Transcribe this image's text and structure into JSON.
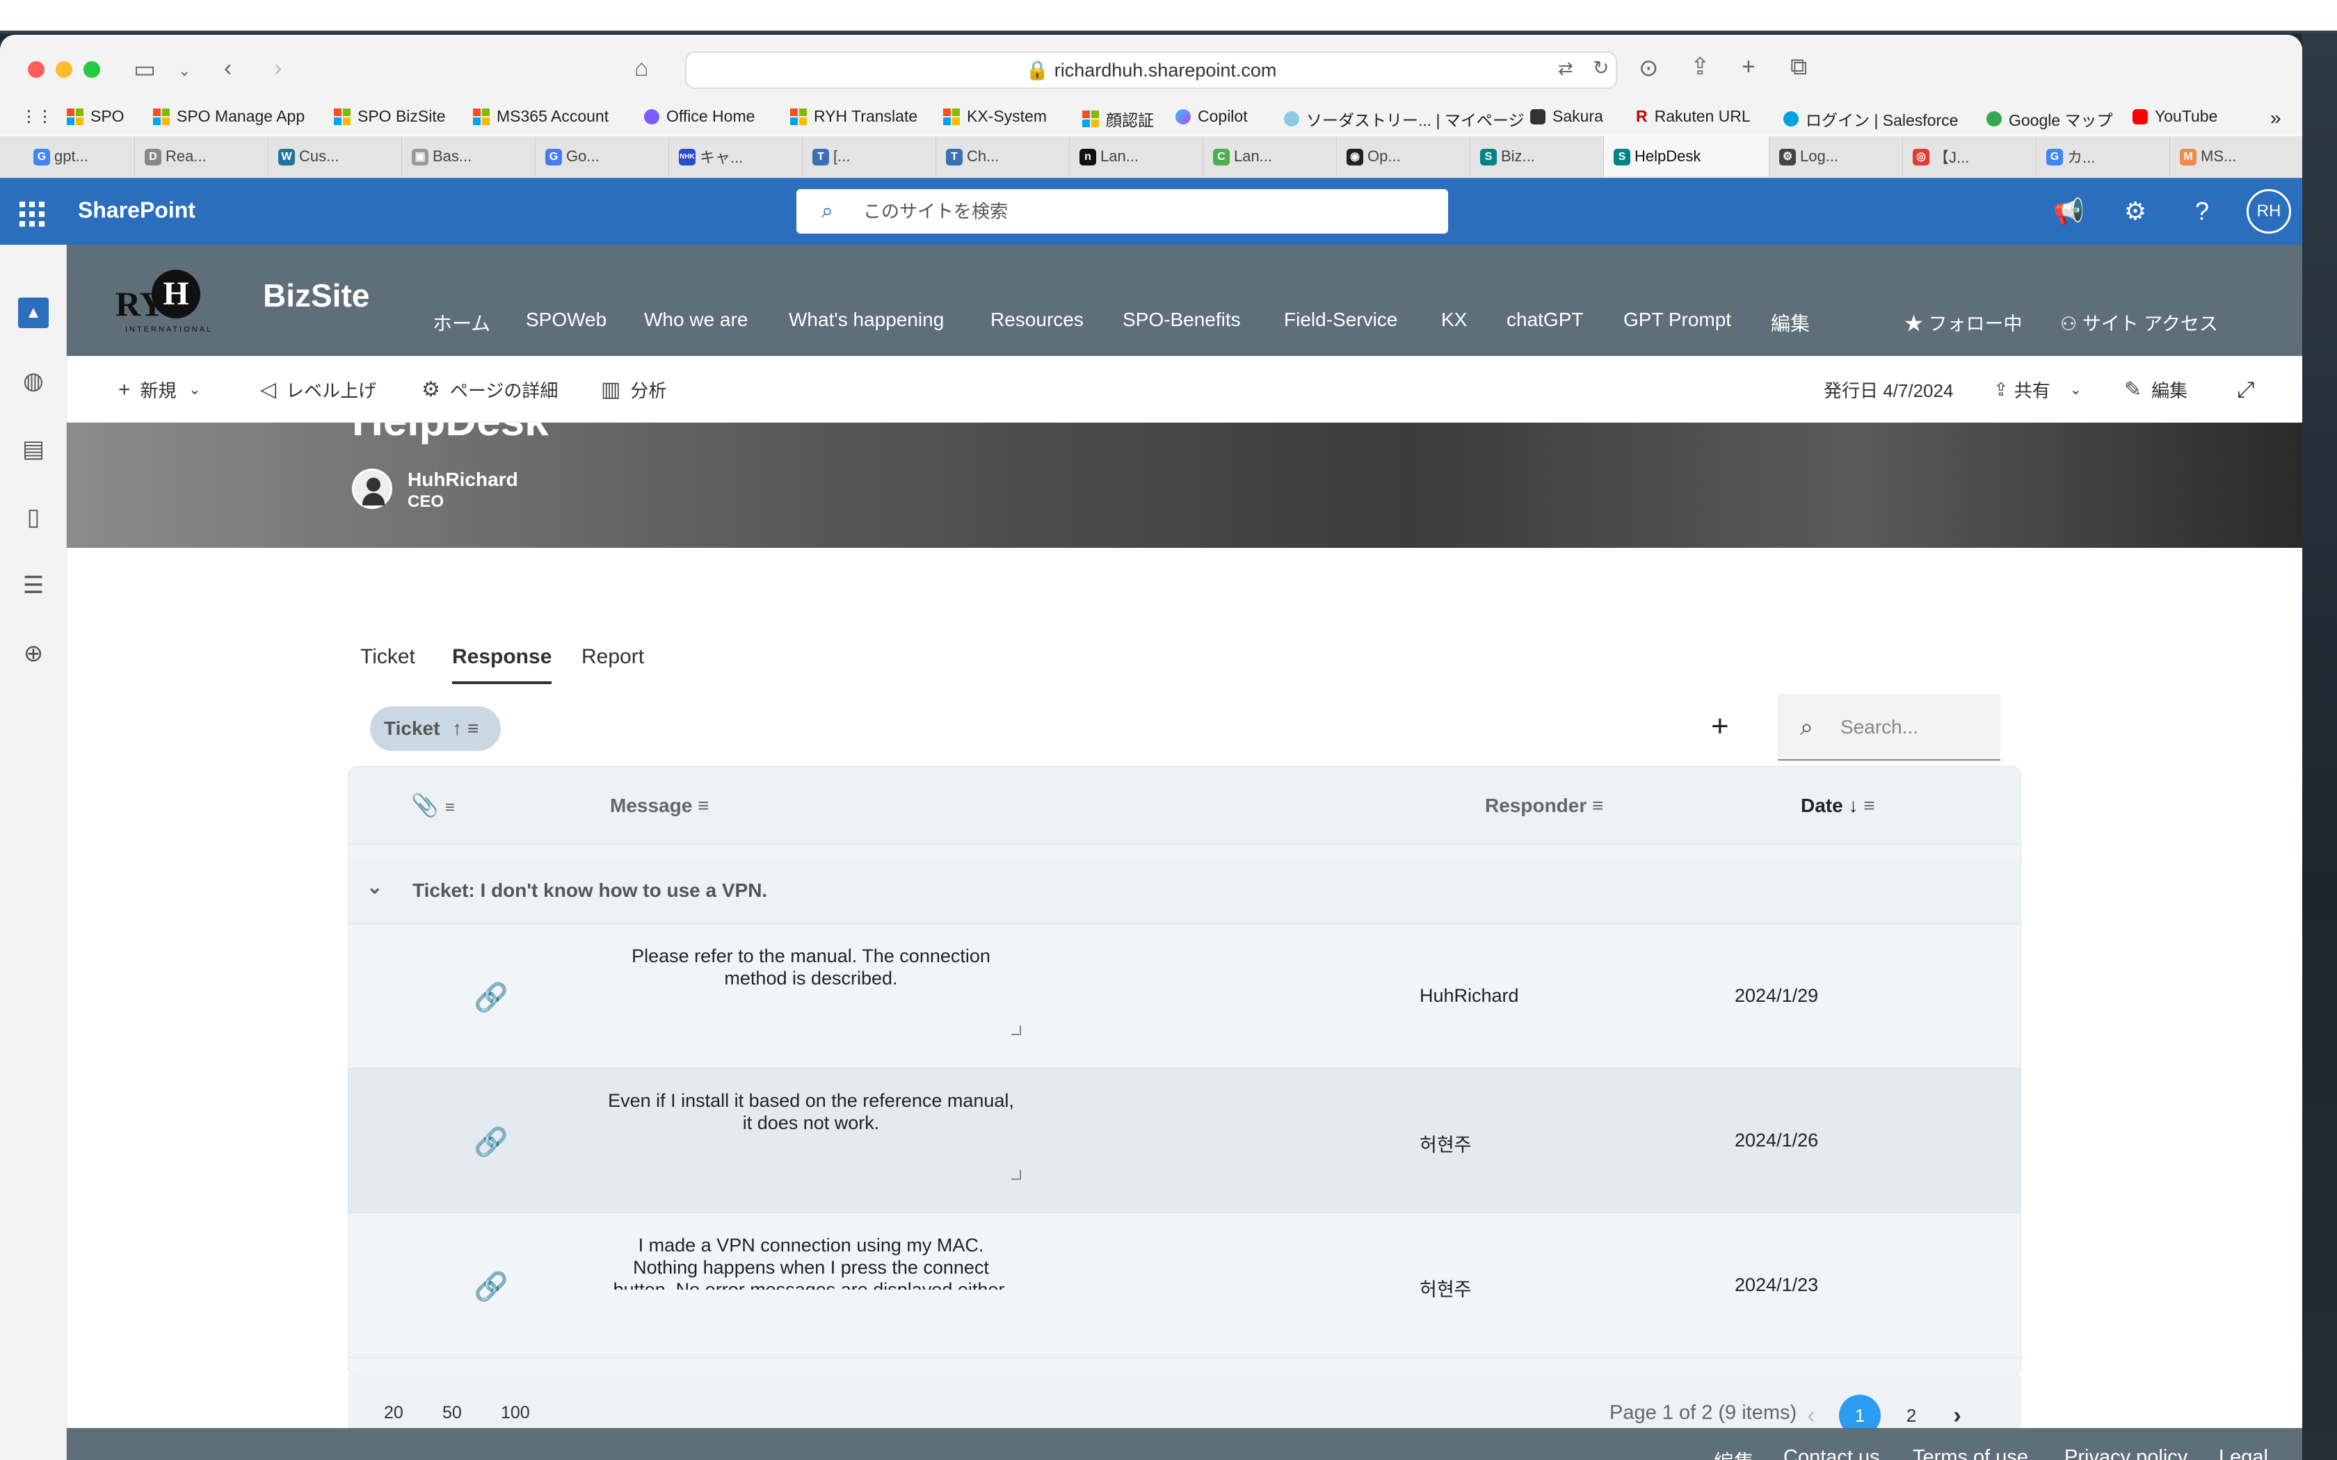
{
  "browser": {
    "url": "richardhuh.sharepoint.com",
    "bookmarks": [
      "SPO",
      "SPO Manage App",
      "SPO BizSite",
      "MS365 Account",
      "Office Home",
      "RYH Translate",
      "KX-System",
      "顔認証",
      "Copilot",
      "ソーダストリー... | マイページ",
      "Sakura",
      "Rakuten URL",
      "ログイン | Salesforce",
      "Google マップ",
      "YouTube"
    ],
    "tabs": [
      "gpt...",
      "Rea...",
      "Cus...",
      "Bas...",
      "Go...",
      "キャ...",
      "[...",
      "Ch...",
      "Lan...",
      "Lan...",
      "Op...",
      "Biz...",
      "HelpDesk",
      "Log...",
      "【J...",
      "カ...",
      "MS..."
    ],
    "active_tab": "HelpDesk"
  },
  "sharepoint": {
    "app_name": "SharePoint",
    "search_placeholder": "このサイトを検索",
    "avatar_initials": "RH"
  },
  "site": {
    "name": "BizSite",
    "logo_text": "RY",
    "logo_letter": "H",
    "logo_sub": "INTERNATIONAL",
    "nav": [
      "ホーム",
      "SPOWeb",
      "Who we are",
      "What's happening",
      "Resources",
      "SPO-Benefits",
      "Field-Service",
      "KX",
      "chatGPT",
      "GPT Prompt",
      "編集"
    ],
    "follow": "フォロー中",
    "site_access": "サイト アクセス"
  },
  "commandbar": {
    "new": "新規",
    "promote": "レベル上げ",
    "page_details": "ページの詳細",
    "analytics": "分析",
    "published": "発行日 4/7/2024",
    "share": "共有",
    "edit": "編集"
  },
  "hero": {
    "title": "HelpDesk",
    "author": "HuhRichard",
    "role": "CEO"
  },
  "page_tabs": [
    "Ticket",
    "Response",
    "Report"
  ],
  "selected_tab": "Response",
  "group_chip": "Ticket",
  "search_placeholder": "Search...",
  "table": {
    "columns": {
      "message": "Message",
      "responder": "Responder",
      "date": "Date"
    },
    "group_label": "Ticket: I don't know how to use a VPN.",
    "rows": [
      {
        "message": "Please refer to the manual. The connection method is described.",
        "responder": "HuhRichard",
        "date": "2024/1/29"
      },
      {
        "message": "Even if I install it based on the reference manual, it does not work.",
        "responder": "허현주",
        "date": "2024/1/26"
      },
      {
        "message": "I made a VPN connection using my MAC. Nothing happens when I press the connect button. No error messages are displayed either.",
        "responder": "허현주",
        "date": "2024/1/23"
      }
    ]
  },
  "pager": {
    "sizes": [
      "20",
      "50",
      "100"
    ],
    "info": "Page 1 of 2 (9 items)",
    "pages": [
      "1",
      "2"
    ]
  },
  "footer": [
    "編集",
    "Contact us",
    "Terms of use",
    "Privacy policy",
    "Legal"
  ],
  "colors": {
    "sp_blue": "#2a6ebd",
    "header_gray": "#5e6f7a",
    "page_active": "#2b9cf0"
  }
}
